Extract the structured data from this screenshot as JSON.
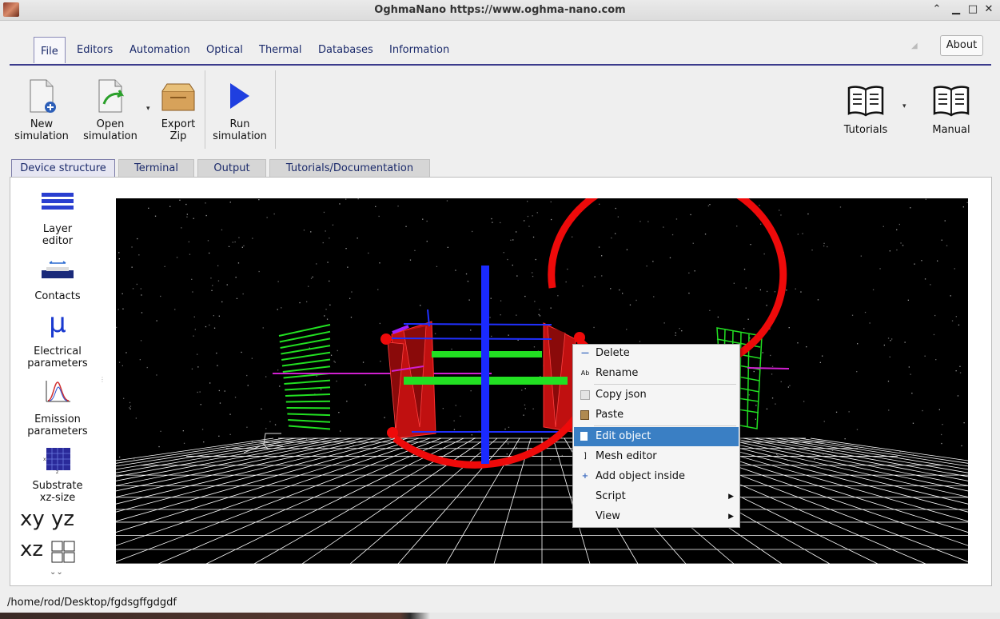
{
  "window": {
    "title": "OghmaNano https://www.oghma-nano.com"
  },
  "ribbon_tabs": [
    "File",
    "Editors",
    "Automation",
    "Optical",
    "Thermal",
    "Databases",
    "Information"
  ],
  "about_label": "About",
  "toolbar": {
    "new_sim": [
      "New",
      "simulation"
    ],
    "open_sim": [
      "Open",
      "simulation"
    ],
    "export_zip": [
      "Export",
      "Zip"
    ],
    "run_sim": [
      "Run",
      "simulation"
    ],
    "tutorials": "Tutorials",
    "manual": "Manual"
  },
  "subtabs": [
    "Device structure",
    "Terminal",
    "Output",
    "Tutorials/Documentation"
  ],
  "sidebar": {
    "layer_editor": [
      "Layer",
      "editor"
    ],
    "contacts": "Contacts",
    "mu_glyph": "μ",
    "electrical": [
      "Electrical",
      "parameters"
    ],
    "emission": [
      "Emission",
      "parameters"
    ],
    "substrate": [
      "Substrate",
      "xz-size"
    ],
    "view_xy": "xy",
    "view_yz": "yz",
    "view_xz": "xz"
  },
  "context_menu": {
    "delete": "Delete",
    "rename": "Rename",
    "copy_json": "Copy json",
    "paste": "Paste",
    "edit_object": "Edit object",
    "mesh_editor": "Mesh editor",
    "add_object_inside": "Add object inside",
    "script": "Script",
    "view": "View"
  },
  "status_path": "/home/rod/Desktop/fgdsgffgdgdf",
  "colors": {
    "accent": "#3a7fc4",
    "tab_text": "#1b2a6b",
    "viewport_bg": "#000000"
  }
}
